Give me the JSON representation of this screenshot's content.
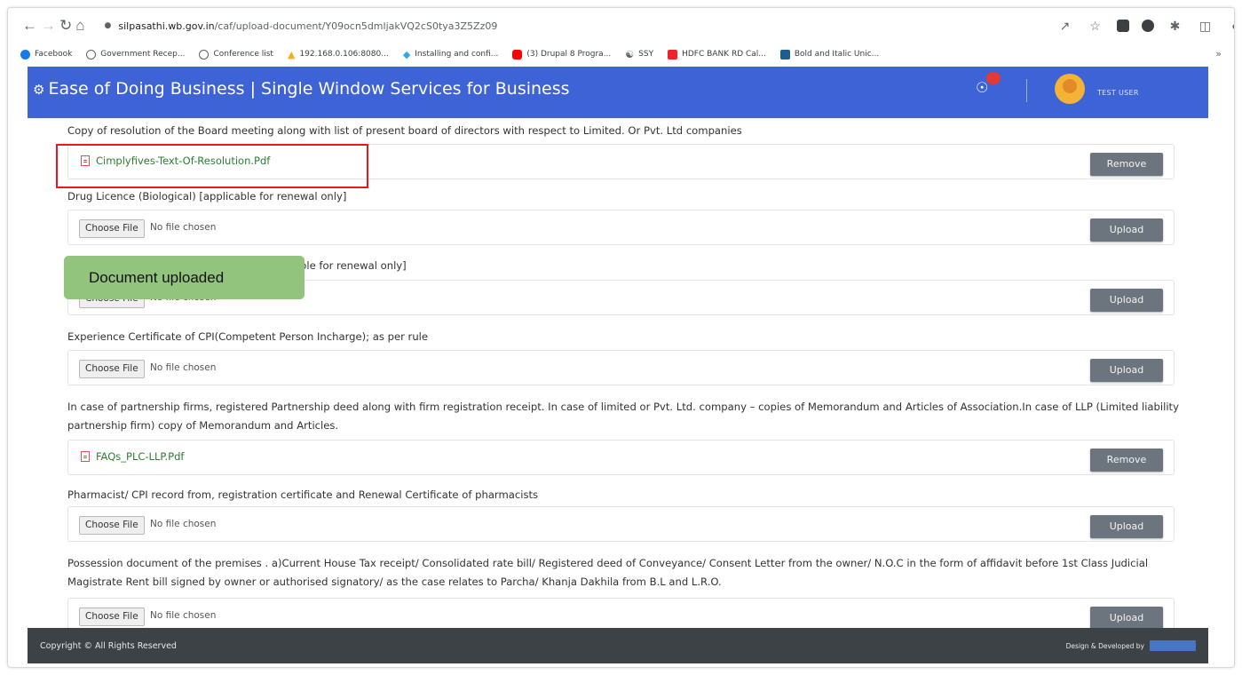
{
  "browser": {
    "url_host": "silpasathi.wb.gov.in",
    "url_path": "/caf/upload-document/Y09ocn5dmljakVQ2cS0tya3Z5Zz09",
    "bookmarks": [
      {
        "label": "Facebook",
        "icon": "facebook-icon",
        "color": "#1877f2"
      },
      {
        "label": "Government Recep...",
        "icon": "globe-icon",
        "color": "#5f6368"
      },
      {
        "label": "Conference list",
        "icon": "globe-icon",
        "color": "#5f6368"
      },
      {
        "label": "192.168.0.106:8080...",
        "icon": "warning-icon",
        "color": "#f2b01e"
      },
      {
        "label": "Installing and confi...",
        "icon": "drupal-icon",
        "color": "#2ba9e0"
      },
      {
        "label": "(3) Drupal 8 Progra...",
        "icon": "youtube-icon",
        "color": "#ff0000"
      },
      {
        "label": "SSY",
        "icon": "bank-icon",
        "color": "#5f6368"
      },
      {
        "label": "HDFC BANK RD Cal...",
        "icon": "hdfc-icon",
        "color": "#ed232a"
      },
      {
        "label": "Bold and Italic Unic...",
        "icon": "table-icon",
        "color": "#1e8e3e"
      }
    ]
  },
  "header": {
    "title": "Ease of Doing Business | Single Window Services for Business",
    "user_name": "TEST USER",
    "color": "#3d63d6"
  },
  "documents": [
    {
      "label": "Copy of resolution of the Board meeting along with list of present board of directors with respect to Limited. Or Pvt. Ltd companies",
      "status": "uploaded",
      "file_name": "Cimplyfives-Text-Of-Resolution.Pdf",
      "action": "Remove"
    },
    {
      "label": "Drug Licence (Biological) [applicable for renewal only]",
      "status": "empty",
      "choose_label": "Choose File",
      "no_file": "No file chosen",
      "action": "Upload"
    },
    {
      "label": "ble for renewal only]",
      "status": "empty",
      "choose_label": "Choose File",
      "no_file": "No file chosen",
      "action": "Upload"
    },
    {
      "label": "Experience Certificate of CPI(Competent Person Incharge); as per rule",
      "status": "empty",
      "choose_label": "Choose File",
      "no_file": "No file chosen",
      "action": "Upload"
    },
    {
      "label": "In case of partnership firms, registered Partnership deed along with firm registration receipt. In case of limited or Pvt. Ltd. company – copies of Memorandum and Articles of Association.In case of LLP (Limited liability partnership firm) copy of Memorandum and Articles.",
      "status": "uploaded",
      "file_name": "FAQs_PLC-LLP.Pdf",
      "action": "Remove"
    },
    {
      "label": "Pharmacist/ CPI record from, registration certificate and Renewal Certificate of pharmacists",
      "status": "empty",
      "choose_label": "Choose File",
      "no_file": "No file chosen",
      "action": "Upload"
    },
    {
      "label": "Possession document of the premises . a)Current House Tax receipt/ Consolidated rate bill/ Registered deed of Conveyance/ Consent Letter from the owner/ N.O.C in the form of affidavit before 1st Class Judicial Magistrate Rent bill signed by owner or authorised signatory/ as the case relates to Parcha/ Khanja Dakhila from B.L and L.R.O.",
      "status": "empty",
      "choose_label": "Choose File",
      "no_file": "No file chosen",
      "action": "Upload"
    }
  ],
  "annotation": {
    "callout_text": "Document uploaded"
  },
  "footer": {
    "copyright": "Copyright © All Rights Reserved",
    "design": "Design & Developed by"
  }
}
